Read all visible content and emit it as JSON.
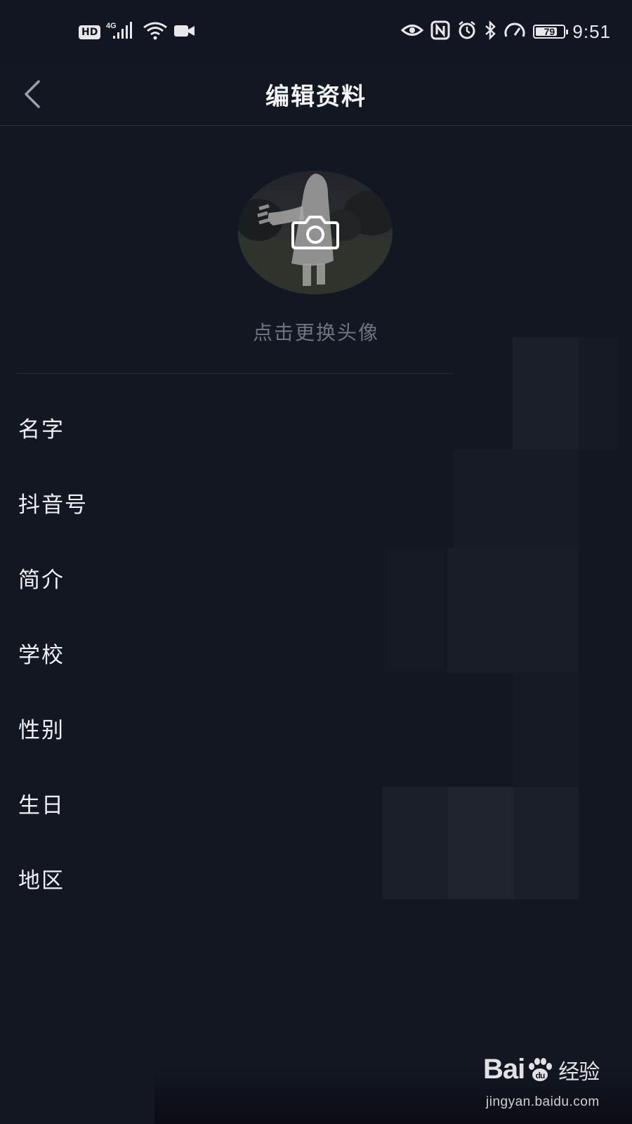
{
  "status_bar": {
    "left_icons": [
      "hd-icon",
      "signal-4g-icon",
      "wifi-icon",
      "video-camera-icon"
    ],
    "hd_label": "HD",
    "network_label": "4G",
    "right_icons": [
      "eye-icon",
      "nfc-icon",
      "alarm-icon",
      "bluetooth-icon",
      "speedometer-icon",
      "battery-icon"
    ],
    "battery_level": "79",
    "time": "9:51"
  },
  "header": {
    "back_icon": "chevron-left-icon",
    "title": "编辑资料"
  },
  "avatar": {
    "overlay_icon": "camera-icon",
    "change_label": "点击更换头像"
  },
  "fields": [
    {
      "label": "名字"
    },
    {
      "label": "抖音号"
    },
    {
      "label": "简介"
    },
    {
      "label": "学校"
    },
    {
      "label": "性别"
    },
    {
      "label": "生日"
    },
    {
      "label": "地区"
    }
  ],
  "watermark": {
    "brand": "Bai",
    "brand_tail": "经验",
    "url": "jingyan.baidu.com"
  },
  "colors": {
    "background": "#131722",
    "text_primary": "#f0f1f4",
    "text_muted": "#6f7380",
    "divider": "#262b36"
  }
}
